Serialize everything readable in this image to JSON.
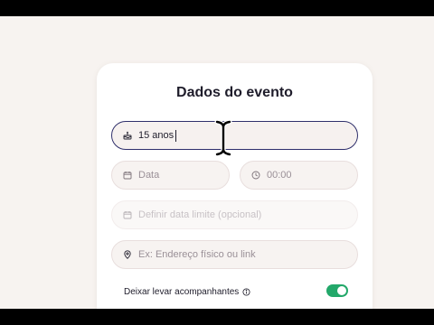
{
  "form": {
    "title": "Dados do evento",
    "event_type": {
      "value": "15 anos",
      "icon": "cake-icon"
    },
    "date": {
      "placeholder": "Data",
      "icon": "calendar-icon"
    },
    "time": {
      "placeholder": "00:00",
      "icon": "clock-icon"
    },
    "deadline": {
      "placeholder": "Definir data limite (opcional)",
      "icon": "calendar-icon"
    },
    "location": {
      "placeholder": "Ex: Endereço físico ou link",
      "icon": "map-pin-icon"
    },
    "companions": {
      "label": "Deixar levar acompanhantes",
      "enabled": true
    }
  },
  "colors": {
    "accent": "#2f2f6b",
    "toggle_on": "#23a86a",
    "background": "#f7f3f0"
  }
}
